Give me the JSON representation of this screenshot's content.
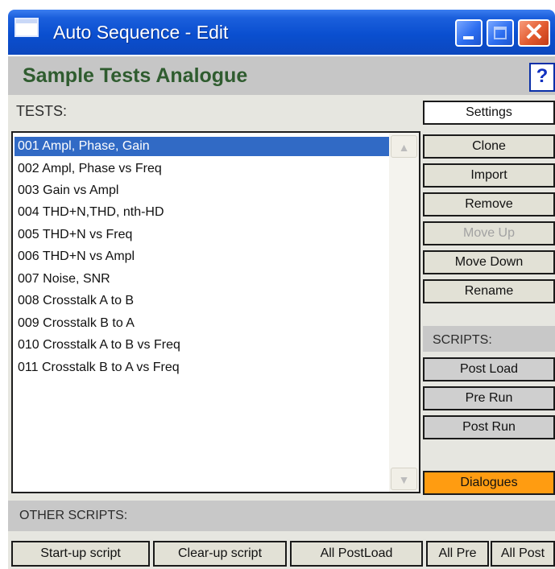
{
  "window": {
    "title": "Auto Sequence  - Edit",
    "controls": {
      "minimize": "minimize",
      "maximize": "maximize",
      "close": "✕"
    }
  },
  "header": {
    "title": "Sample Tests Analogue",
    "help_label": "?"
  },
  "tests": {
    "label": "TESTS:",
    "items": [
      "001 Ampl, Phase, Gain",
      "002 Ampl, Phase vs Freq",
      "003 Gain vs Ampl",
      "004 THD+N,THD, nth-HD",
      "005 THD+N vs Freq",
      "006 THD+N vs Ampl",
      "007 Noise, SNR",
      "008 Crosstalk A to B",
      "009 Crosstalk B to A",
      "010 Crosstalk A to B vs Freq",
      "011 Crosstalk B to A vs Freq"
    ],
    "selected_index": 0
  },
  "actions": {
    "settings": "Settings",
    "clone": "Clone",
    "import": "Import",
    "remove": "Remove",
    "move_up": "Move Up",
    "move_down": "Move Down",
    "rename": "Rename"
  },
  "scripts": {
    "label": "SCRIPTS:",
    "post_load": "Post Load",
    "pre_run": "Pre Run",
    "post_run": "Post Run"
  },
  "dialogues": "Dialogues",
  "other_scripts": {
    "label": "OTHER SCRIPTS:",
    "startup": "Start-up script",
    "clearup": "Clear-up script",
    "all_postload": "All PostLoad",
    "all_pre": "All Pre",
    "all_post": "All Post"
  },
  "colors": {
    "selection": "#316ac5",
    "dialogues": "#ff9c11",
    "title_bar": "#0a4fd0",
    "page_title": "#2f5c2f"
  }
}
